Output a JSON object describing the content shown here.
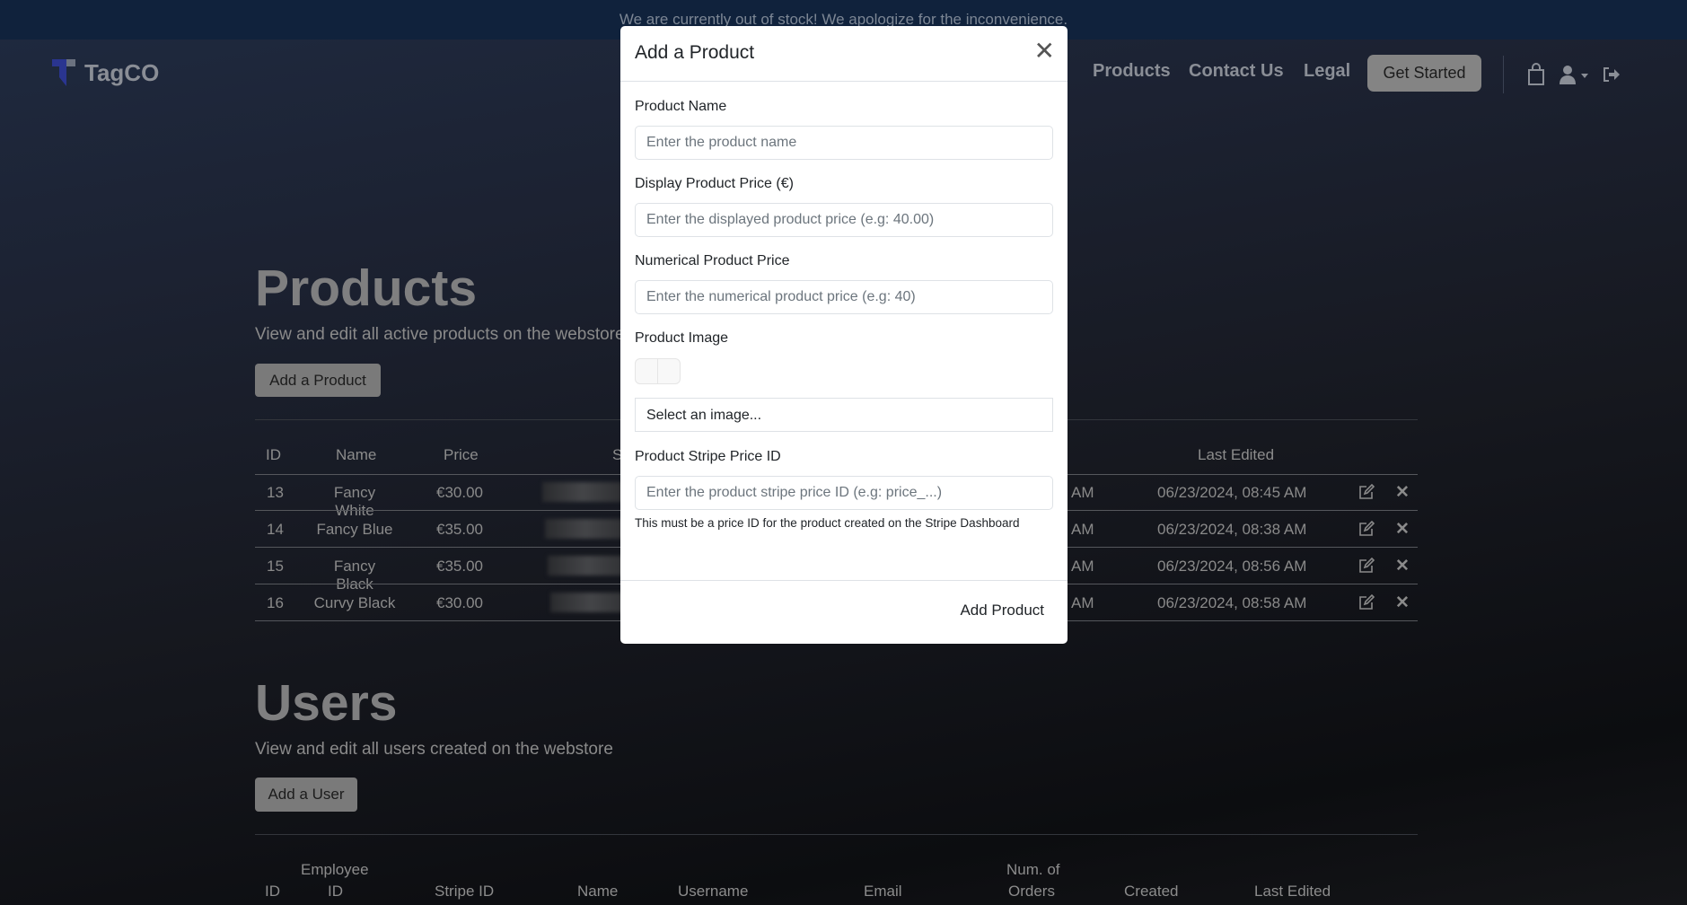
{
  "banner": "We are currently out of stock! We apologize for the inconvenience.",
  "brand": "TagCO",
  "nav": {
    "items": [
      "Products",
      "Contact Us",
      "Legal"
    ],
    "cta": "Get Started"
  },
  "products": {
    "title": "Products",
    "subtitle": "View and edit all active products on the webstore",
    "add_button": "Add a Product",
    "headers": {
      "id": "ID",
      "name": "Name",
      "price": "Price",
      "stripe": "S",
      "last_edited": "Last Edited"
    },
    "rows": [
      {
        "id": "13",
        "name": "Fancy White",
        "price": "€30.00",
        "created_suffix": "AM",
        "last_edited": "06/23/2024, 08:45 AM"
      },
      {
        "id": "14",
        "name": "Fancy Blue",
        "price": "€35.00",
        "created_suffix": "AM",
        "last_edited": "06/23/2024, 08:38 AM"
      },
      {
        "id": "15",
        "name": "Fancy Black",
        "price": "€35.00",
        "created_suffix": "AM",
        "last_edited": "06/23/2024, 08:56 AM"
      },
      {
        "id": "16",
        "name": "Curvy Black",
        "price": "€30.00",
        "created_suffix": "AM",
        "last_edited": "06/23/2024, 08:58 AM"
      }
    ]
  },
  "users": {
    "title": "Users",
    "subtitle": "View and edit all users created on the webstore",
    "add_button": "Add a User",
    "headers": {
      "id": "ID",
      "employee_1": "Employee",
      "employee_2": "ID",
      "stripe": "Stripe ID",
      "name": "Name",
      "username": "Username",
      "email": "Email",
      "orders_1": "Num. of",
      "orders_2": "Orders",
      "created": "Created",
      "last_edited": "Last Edited"
    }
  },
  "modal": {
    "title": "Add a Product",
    "name_label": "Product Name",
    "name_placeholder": "Enter the product name",
    "display_price_label": "Display Product Price (€)",
    "display_price_placeholder": "Enter the displayed product price (e.g: 40.00)",
    "num_price_label": "Numerical Product Price",
    "num_price_placeholder": "Enter the numerical product price (e.g: 40)",
    "image_label": "Product Image",
    "image_select": "Select an image...",
    "stripe_label": "Product Stripe Price ID",
    "stripe_placeholder": "Enter the product stripe price ID (e.g: price_...)",
    "help": "This must be a price ID for the product created on the Stripe Dashboard",
    "submit": "Add Product"
  }
}
